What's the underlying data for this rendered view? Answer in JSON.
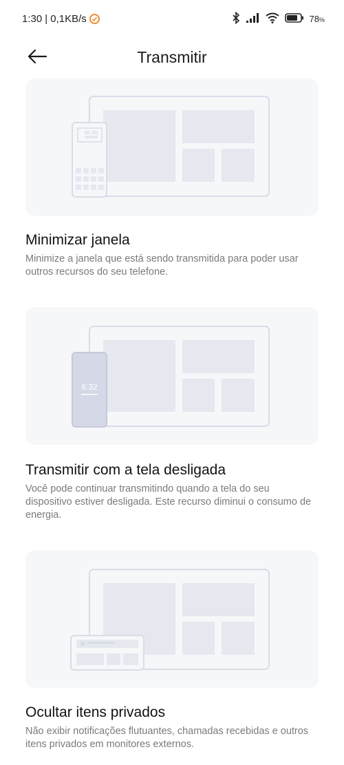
{
  "status_bar": {
    "time": "1:30",
    "network_speed": "| 0,1KB/s",
    "battery_percent": "78",
    "battery_suffix": "%",
    "icons": [
      "app-notification-icon",
      "bluetooth-icon",
      "signal-icon",
      "wifi-icon",
      "battery-icon"
    ]
  },
  "header": {
    "back_icon": "arrow-left-icon",
    "title": "Transmitir"
  },
  "features": [
    {
      "title": "Minimizar janela",
      "description": "Minimize a janela que está sendo transmitida para poder usar outros recursos do seu telefone."
    },
    {
      "title": "Transmitir com a tela desligada",
      "description": "Você pode continuar transmitindo quando a tela do seu dispositivo estiver desligada. Este recurso diminui o consumo de energia.",
      "phone_clock": "6:32"
    },
    {
      "title": "Ocultar itens privados",
      "description": "Não exibir notificações flutuantes, chamadas recebidas e outros itens privados em monitores externos."
    }
  ],
  "colors": {
    "card_bg": "#f6f7f9",
    "outline": "#d9dce8",
    "block": "#e6e8ef",
    "phone_dark": "#d5d8e6",
    "notification_badge": "#f08a2e"
  }
}
